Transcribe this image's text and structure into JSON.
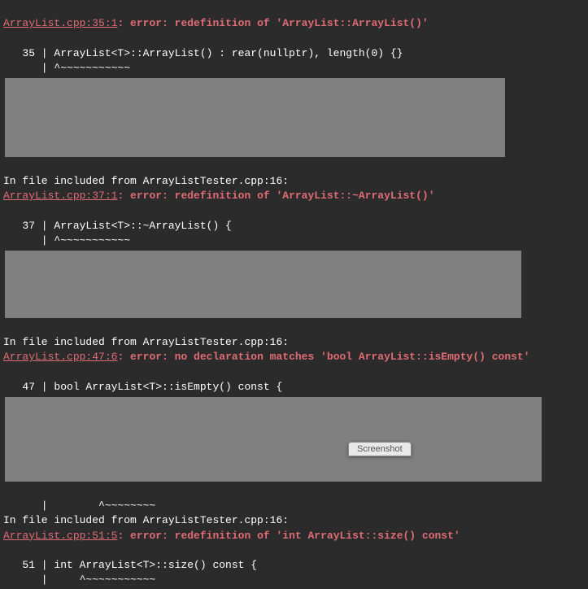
{
  "err1": {
    "file": "ArrayList.cpp:35:1",
    "sep": ": ",
    "label": "error: ",
    "msg": "redefinition of 'ArrayList::ArrayList()'",
    "code": "   35 | ArrayList<T>::ArrayList() : rear(nullptr), length(0) {}",
    "caret": "      | ^~~~~~~~~~~~"
  },
  "include1": "In file included from ArrayListTester.cpp:16:",
  "err2": {
    "file": "ArrayList.cpp:37:1",
    "sep": ": ",
    "label": "error: ",
    "msg": "redefinition of 'ArrayList::~ArrayList()'",
    "code": "   37 | ArrayList<T>::~ArrayList() {",
    "caret": "      | ^~~~~~~~~~~~"
  },
  "include2": "In file included from ArrayListTester.cpp:16:",
  "err3": {
    "file": "ArrayList.cpp:47:6",
    "sep": ": ",
    "label": "error: ",
    "msg": "no declaration matches 'bool ArrayList::isEmpty() const'",
    "code": "   47 | bool ArrayList<T>::isEmpty() const {"
  },
  "caret3_partial": "      |        ^~~~~~~~~",
  "include3": "In file included from ArrayListTester.cpp:16:",
  "err4": {
    "file": "ArrayList.cpp:51:5",
    "sep": ": ",
    "label": "error: ",
    "msg": "redefinition of 'int ArrayList::size() const'",
    "code": "   51 | int ArrayList<T>::size() const {",
    "caret": "      |     ^~~~~~~~~~~~"
  },
  "button_label": "Screenshot"
}
